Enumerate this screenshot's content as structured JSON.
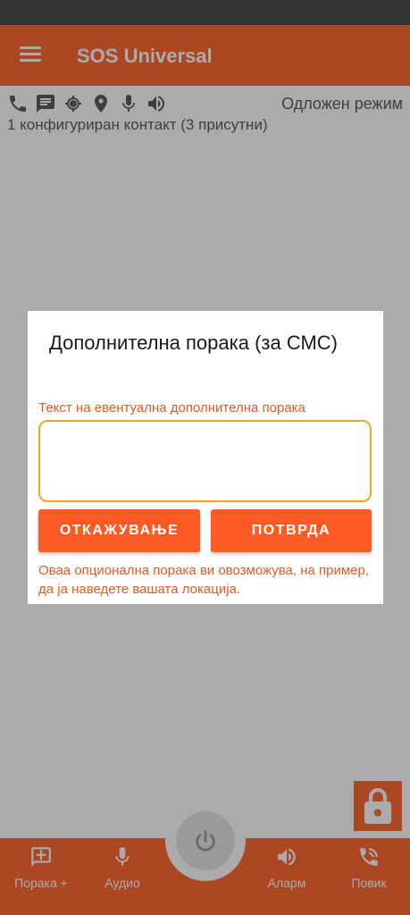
{
  "app": {
    "title": "SOS Universal"
  },
  "status": {
    "mode": "Одложен режим",
    "contacts": "1 конфигуриран контакт (3 присутни)"
  },
  "dialog": {
    "title": "Дополнителна порака (за СМС)",
    "field_label": "Текст на евентуална дополнителна порака",
    "text_value": "",
    "cancel_label": "ОТКАЖУВАЊЕ",
    "confirm_label": "ПОТВРДА",
    "help_text": "Оваа опционална порака ви овозможува, на пример, да ја наведете вашата локација."
  },
  "bottom_nav": {
    "message_label": "Порака +",
    "audio_label": "Аудио",
    "alarm_label": "Аларм",
    "call_label": "Повик"
  },
  "colors": {
    "accent": "#ff6a33",
    "button": "#ff5a24",
    "label": "#e65a24",
    "field_border": "#f2a51e"
  }
}
